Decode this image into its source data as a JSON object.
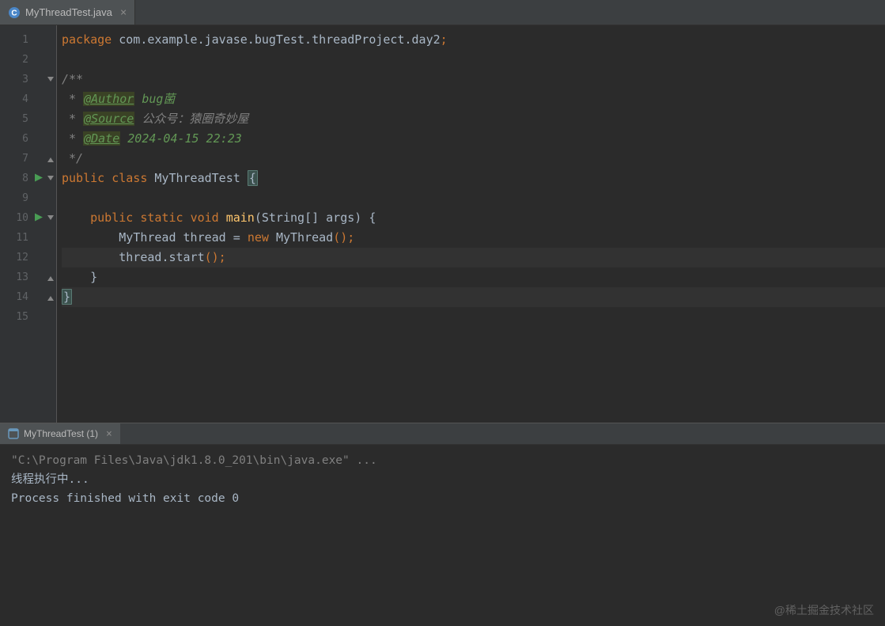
{
  "tab": {
    "filename": "MyThreadTest.java",
    "close": "×"
  },
  "gutter": {
    "lines": [
      "1",
      "2",
      "3",
      "4",
      "5",
      "6",
      "7",
      "8",
      "9",
      "10",
      "11",
      "12",
      "13",
      "14",
      "15"
    ]
  },
  "code": {
    "l1": {
      "kw_package": "package",
      "pkg": " com.example.javase.bugTest.threadProject.day2",
      "semi": ";"
    },
    "l3": {
      "open": "/**"
    },
    "l4": {
      "star": " * ",
      "tag": "@Author",
      "val": " bug菌"
    },
    "l5": {
      "star": " * ",
      "tag": "@Source",
      "val": " 公众号：猿圈奇妙屋"
    },
    "l6": {
      "star": " * ",
      "tag": "@Date",
      "val": " 2024-04-15 22:23"
    },
    "l7": {
      "close": " */"
    },
    "l8": {
      "kw_public": "public",
      "sp1": " ",
      "kw_class": "class",
      "sp2": " ",
      "cls": "MyThreadTest",
      "sp3": " ",
      "brace": "{"
    },
    "l10": {
      "indent": "    ",
      "kw_public": "public",
      "sp1": " ",
      "kw_static": "static",
      "sp2": " ",
      "kw_void": "void",
      "sp3": " ",
      "method": "main",
      "open_p": "(",
      "type": "String",
      "arr": "[] args",
      "close_p": ")",
      "sp4": " ",
      "brace": "{"
    },
    "l11": {
      "indent": "        ",
      "type": "MyThread",
      "sp1": " ",
      "var": "thread",
      "sp2": " = ",
      "kw_new": "new",
      "sp3": " ",
      "ctor": "MyThread",
      "call": "();"
    },
    "l12": {
      "indent": "        ",
      "var": "thread",
      "dot": ".",
      "method": "start",
      "call": "();"
    },
    "l13": {
      "indent": "    ",
      "brace": "}"
    },
    "l14": {
      "brace": "}"
    }
  },
  "console": {
    "tab_label": "MyThreadTest (1)",
    "tab_close": "×",
    "line1": "\"C:\\Program Files\\Java\\jdk1.8.0_201\\bin\\java.exe\" ...",
    "line2": "线程执行中...",
    "line3": "",
    "line4": "Process finished with exit code 0"
  },
  "watermark": "@稀土掘金技术社区"
}
